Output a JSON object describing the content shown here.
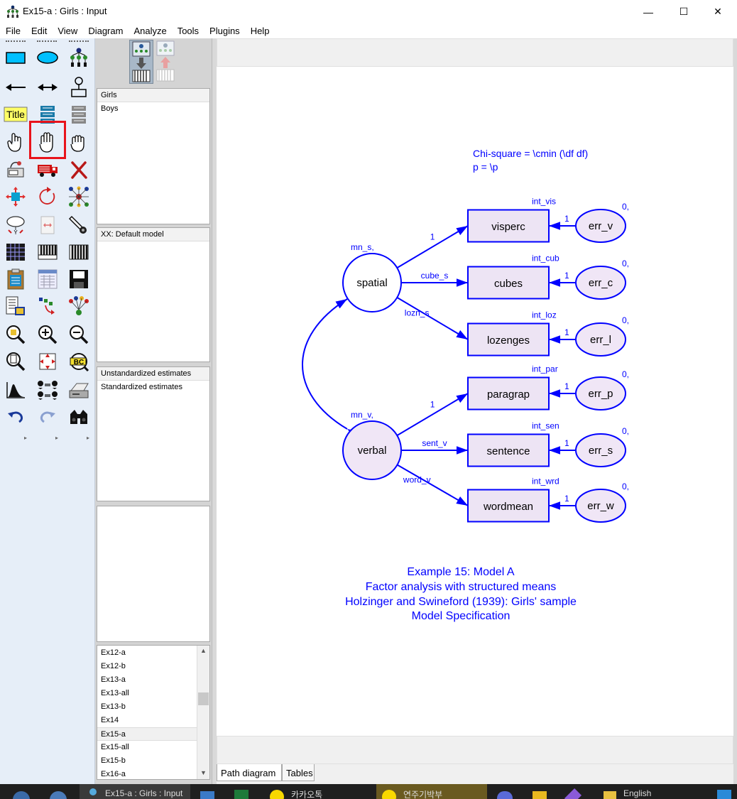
{
  "window": {
    "title": "Ex15-a : Girls : Input",
    "controls": [
      "—",
      "☐",
      "✕"
    ]
  },
  "menu": [
    "File",
    "Edit",
    "View",
    "Diagram",
    "Analyze",
    "Tools",
    "Plugins",
    "Help"
  ],
  "toolbox": {
    "title_tool_label": "Title",
    "bc_label": "BC",
    "selected_tool": "move-tool-icon",
    "tools": [
      "draw-observed-variable-icon",
      "draw-unobserved-variable-icon",
      "draw-latent-indicator-icon",
      "single-headed-arrow-icon",
      "double-headed-arrow-icon",
      "add-unique-variable-icon",
      "figure-caption-icon",
      "list-variables-in-model-icon",
      "list-variables-in-dataset-icon",
      "select-one-object-icon",
      "select-all-objects-icon",
      "deselect-all-icon",
      "duplicate-objects-icon",
      "move-objects-icon",
      "erase-objects-icon",
      "change-shape-icon",
      "rotate-indicators-icon",
      "reflect-indicators-icon",
      "move-parameter-icon",
      "scroll-icon",
      "touch-up-icon",
      "select-data-files-icon",
      "analysis-properties-icon",
      "calculate-estimates-icon",
      "copy-to-clipboard-icon",
      "view-text-icon",
      "save-diagram-icon",
      "object-properties-icon",
      "drag-properties-icon",
      "preserve-symmetries-icon",
      "zoom-in-area-icon",
      "zoom-in-icon",
      "zoom-out-icon",
      "show-whole-page-icon",
      "resize-diagram-icon",
      "bayesian-estimation-icon",
      "degrees-of-freedom-icon",
      "multiple-group-analysis-icon",
      "print-diagram-icon",
      "undo-icon",
      "redo-icon",
      "specification-search-icon"
    ]
  },
  "panels": {
    "groups": [
      "Girls",
      "Boys"
    ],
    "models": [
      "XX: Default model"
    ],
    "estimates": [
      "Unstandardized estimates",
      "Standardized estimates"
    ],
    "files": [
      "Ex12-a",
      "Ex12-b",
      "Ex13-a",
      "Ex13-all",
      "Ex13-b",
      "Ex14",
      "Ex15-a",
      "Ex15-all",
      "Ex15-b",
      "Ex16-a"
    ],
    "selected_file": "Ex15-a"
  },
  "diagram": {
    "fit_text": [
      "Chi-square = \\cmin (\\df df)",
      "p = \\p"
    ],
    "latents": [
      {
        "name": "spatial",
        "mean_label": "mn_s,"
      },
      {
        "name": "verbal",
        "mean_label": "mn_v,"
      }
    ],
    "observed": [
      {
        "name": "visperc",
        "intercept": "int_vis",
        "loading": "1",
        "error": "err_v",
        "error_weight": "1",
        "error_mean": "0,"
      },
      {
        "name": "cubes",
        "intercept": "int_cub",
        "loading": "cube_s",
        "error": "err_c",
        "error_weight": "1",
        "error_mean": "0,"
      },
      {
        "name": "lozenges",
        "intercept": "int_loz",
        "loading": "lozn_s",
        "error": "err_l",
        "error_weight": "1",
        "error_mean": "0,"
      },
      {
        "name": "paragrap",
        "intercept": "int_par",
        "loading": "1",
        "error": "err_p",
        "error_weight": "1",
        "error_mean": "0,"
      },
      {
        "name": "sentence",
        "intercept": "int_sen",
        "loading": "sent_v",
        "error": "err_s",
        "error_weight": "1",
        "error_mean": "0,"
      },
      {
        "name": "wordmean",
        "intercept": "int_wrd",
        "loading": "word_v",
        "error": "err_w",
        "error_weight": "1",
        "error_mean": "0,"
      }
    ],
    "caption": [
      "Example 15: Model A",
      "Factor analysis with structured means",
      "Holzinger and Swineford (1939):  Girls' sample",
      "Model Specification"
    ],
    "colors": {
      "ink": "#0000ff",
      "fill_light": "#f0e6f6",
      "fill_box": "#ede4f4"
    }
  },
  "tabs": [
    "Path diagram",
    "Tables"
  ],
  "active_tab": "Path diagram",
  "taskbar": {
    "items": [
      "Ex15-a : Girls : Input",
      "카카오톡",
      "연주기박부",
      "English"
    ]
  }
}
